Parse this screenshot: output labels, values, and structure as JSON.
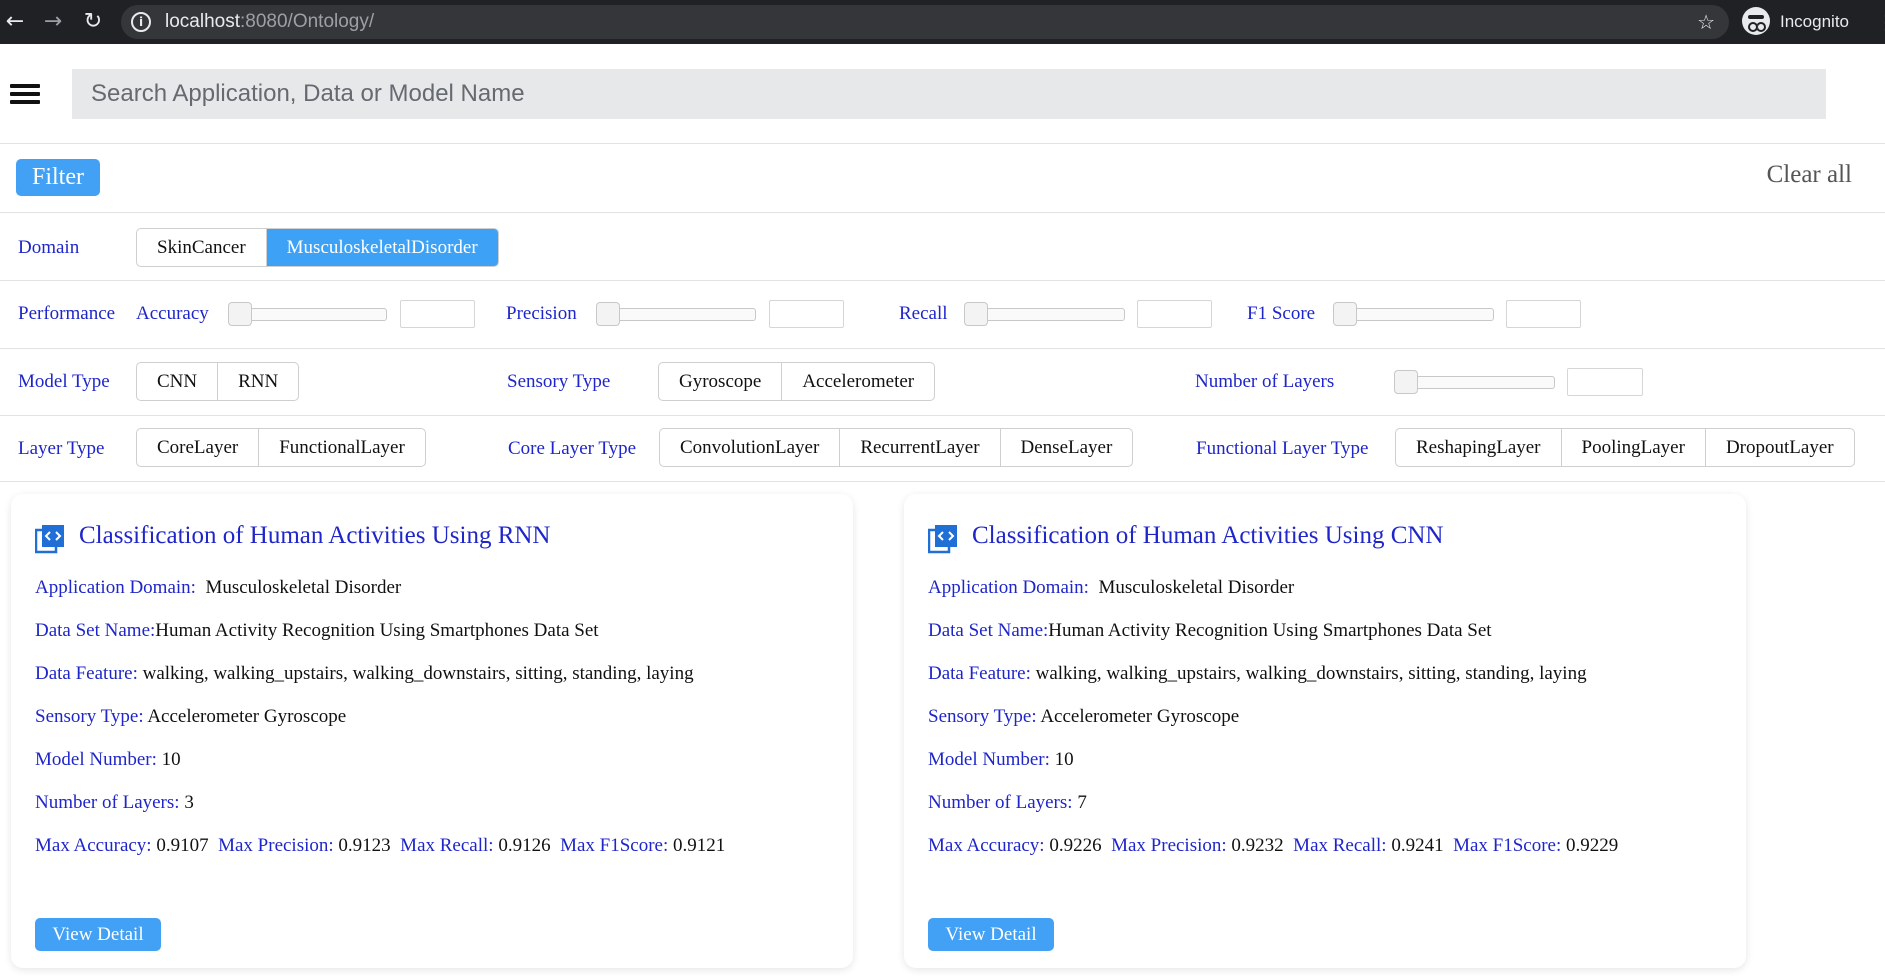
{
  "browser": {
    "url_host": "localhost",
    "url_rest": ":8080/Ontology/",
    "profile_label": "Incognito"
  },
  "search": {
    "placeholder": "Search Application, Data or Model Name"
  },
  "filter": {
    "title": "Filter",
    "clear_all": "Clear all",
    "domain": {
      "label": "Domain",
      "options": [
        "SkinCancer",
        "MusculoskeletalDisorder"
      ],
      "selected": "MusculoskeletalDisorder"
    },
    "performance": {
      "label": "Performance",
      "metrics": [
        {
          "label": "Accuracy",
          "value": 0
        },
        {
          "label": "Precision",
          "value": 0
        },
        {
          "label": "Recall",
          "value": 0
        },
        {
          "label": "F1 Score",
          "value": 0
        }
      ]
    },
    "model_type": {
      "label": "Model Type",
      "options": [
        "CNN",
        "RNN"
      ]
    },
    "sensory_type": {
      "label": "Sensory Type",
      "options": [
        "Gyroscope",
        "Accelerometer"
      ]
    },
    "number_of_layers": {
      "label": "Number of Layers",
      "value": 0
    },
    "layer_type": {
      "label": "Layer Type",
      "options": [
        "CoreLayer",
        "FunctionalLayer"
      ]
    },
    "core_layer_type": {
      "label": "Core Layer Type",
      "options": [
        "ConvolutionLayer",
        "RecurrentLayer",
        "DenseLayer"
      ]
    },
    "functional_layer_type": {
      "label": "Functional Layer Type",
      "options": [
        "ReshapingLayer",
        "PoolingLayer",
        "DropoutLayer"
      ]
    }
  },
  "cards": [
    {
      "title": "Classification of Human Activities Using RNN",
      "application_domain": {
        "key": "Application Domain:",
        "value": "Musculoskeletal Disorder"
      },
      "data_set_name": {
        "key": "Data Set Name:",
        "value": "Human Activity Recognition Using Smartphones Data Set"
      },
      "data_feature": {
        "key": "Data Feature:",
        "value": "walking, walking_upstairs, walking_downstairs, sitting, standing, laying"
      },
      "sensory_type": {
        "key": "Sensory Type:",
        "value": "Accelerometer Gyroscope"
      },
      "model_number": {
        "key": "Model Number:",
        "value": "10"
      },
      "number_of_layers": {
        "key": "Number of Layers:",
        "value": "3"
      },
      "max_accuracy": {
        "key": "Max Accuracy:",
        "value": "0.9107"
      },
      "max_precision": {
        "key": "Max Precision:",
        "value": "0.9123"
      },
      "max_recall": {
        "key": "Max Recall:",
        "value": "0.9126"
      },
      "max_f1score": {
        "key": "Max F1Score:",
        "value": "0.9121"
      },
      "button": "View Detail"
    },
    {
      "title": "Classification of Human Activities Using CNN",
      "application_domain": {
        "key": "Application Domain:",
        "value": "Musculoskeletal Disorder"
      },
      "data_set_name": {
        "key": "Data Set Name:",
        "value": "Human Activity Recognition Using Smartphones Data Set"
      },
      "data_feature": {
        "key": "Data Feature:",
        "value": "walking, walking_upstairs, walking_downstairs, sitting, standing, laying"
      },
      "sensory_type": {
        "key": "Sensory Type:",
        "value": "Accelerometer Gyroscope"
      },
      "model_number": {
        "key": "Model Number:",
        "value": "10"
      },
      "number_of_layers": {
        "key": "Number of Layers:",
        "value": "7"
      },
      "max_accuracy": {
        "key": "Max Accuracy:",
        "value": "0.9226"
      },
      "max_precision": {
        "key": "Max Precision:",
        "value": "0.9232"
      },
      "max_recall": {
        "key": "Max Recall:",
        "value": "0.9241"
      },
      "max_f1score": {
        "key": "Max F1Score:",
        "value": "0.9229"
      },
      "button": "View Detail"
    }
  ],
  "colors": {
    "accent": "#42a0f5",
    "label_blue": "#1f26c9",
    "chrome": "#202124"
  },
  "icons": [
    "back-arrow-icon",
    "forward-arrow-icon",
    "reload-icon",
    "info-icon",
    "star-icon",
    "incognito-icon",
    "menu-dots-icon",
    "hamburger-icon",
    "code-app-icon"
  ]
}
